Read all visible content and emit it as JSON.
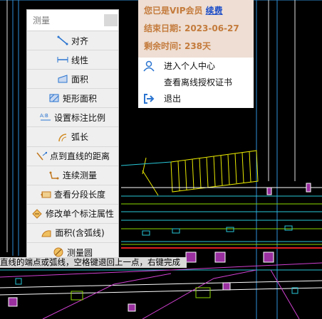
{
  "palette": {
    "title": "测量",
    "items": [
      {
        "label": "对齐",
        "icon": "aligned-dimension-icon"
      },
      {
        "label": "线性",
        "icon": "linear-dimension-icon"
      },
      {
        "label": "面积",
        "icon": "area-icon"
      },
      {
        "label": "矩形面积",
        "icon": "rectangle-area-icon"
      },
      {
        "label": "设置标注比例",
        "icon": "dimension-scale-icon"
      },
      {
        "label": "弧长",
        "icon": "arc-length-icon"
      },
      {
        "label": "点到直线的距离",
        "icon": "point-to-line-icon"
      },
      {
        "label": "连续测量",
        "icon": "continuous-measure-icon"
      },
      {
        "label": "查看分段长度",
        "icon": "segment-length-icon"
      },
      {
        "label": "修改单个标注属性",
        "icon": "edit-dimension-icon"
      },
      {
        "label": "面积(含弧线)",
        "icon": "arc-area-icon"
      },
      {
        "label": "测量圆",
        "icon": "measure-circle-icon"
      }
    ]
  },
  "vip": {
    "status": "您已是VIP会员",
    "renew": "续费",
    "end_date": "结束日期: 2023-06-27",
    "remaining": "剩余时间: 238天",
    "menu": [
      {
        "label": "进入个人中心",
        "icon": "user-icon"
      },
      {
        "label": "查看离线授权证书",
        "icon": ""
      },
      {
        "label": "退出",
        "icon": "logout-icon"
      }
    ]
  },
  "command_line": "直线的端点或弧线，空格键退回上一点，右键完成",
  "colors": {
    "vip_text": "#c47b3c",
    "renew_link": "#1f4fc8",
    "vip_bg": "#eeded3",
    "icon_blue": "#2a74d0"
  }
}
